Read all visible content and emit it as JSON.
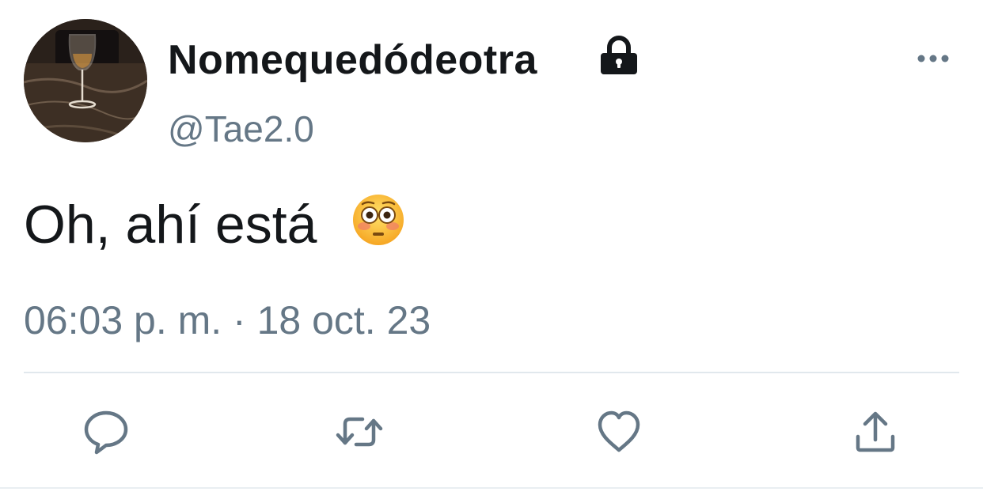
{
  "author": {
    "display_name": "Nomequedódeotra",
    "handle": "@Tae2.0",
    "protected_icon": "lock-icon",
    "avatar_icon": "avatar-wine-glass"
  },
  "tweet": {
    "text": "Oh, ahí está",
    "emoji": "flushed-face-emoji",
    "timestamp": "06:03 p. m. · 18 oct. 23"
  },
  "actions": [
    {
      "name": "reply",
      "icon": "reply-icon"
    },
    {
      "name": "retweet",
      "icon": "retweet-icon"
    },
    {
      "name": "like",
      "icon": "like-icon"
    },
    {
      "name": "share",
      "icon": "share-icon"
    }
  ],
  "menu_icon": "more-icon",
  "colors": {
    "text": "#14171a",
    "secondary": "#657786",
    "divider": "#e1e8ed"
  }
}
